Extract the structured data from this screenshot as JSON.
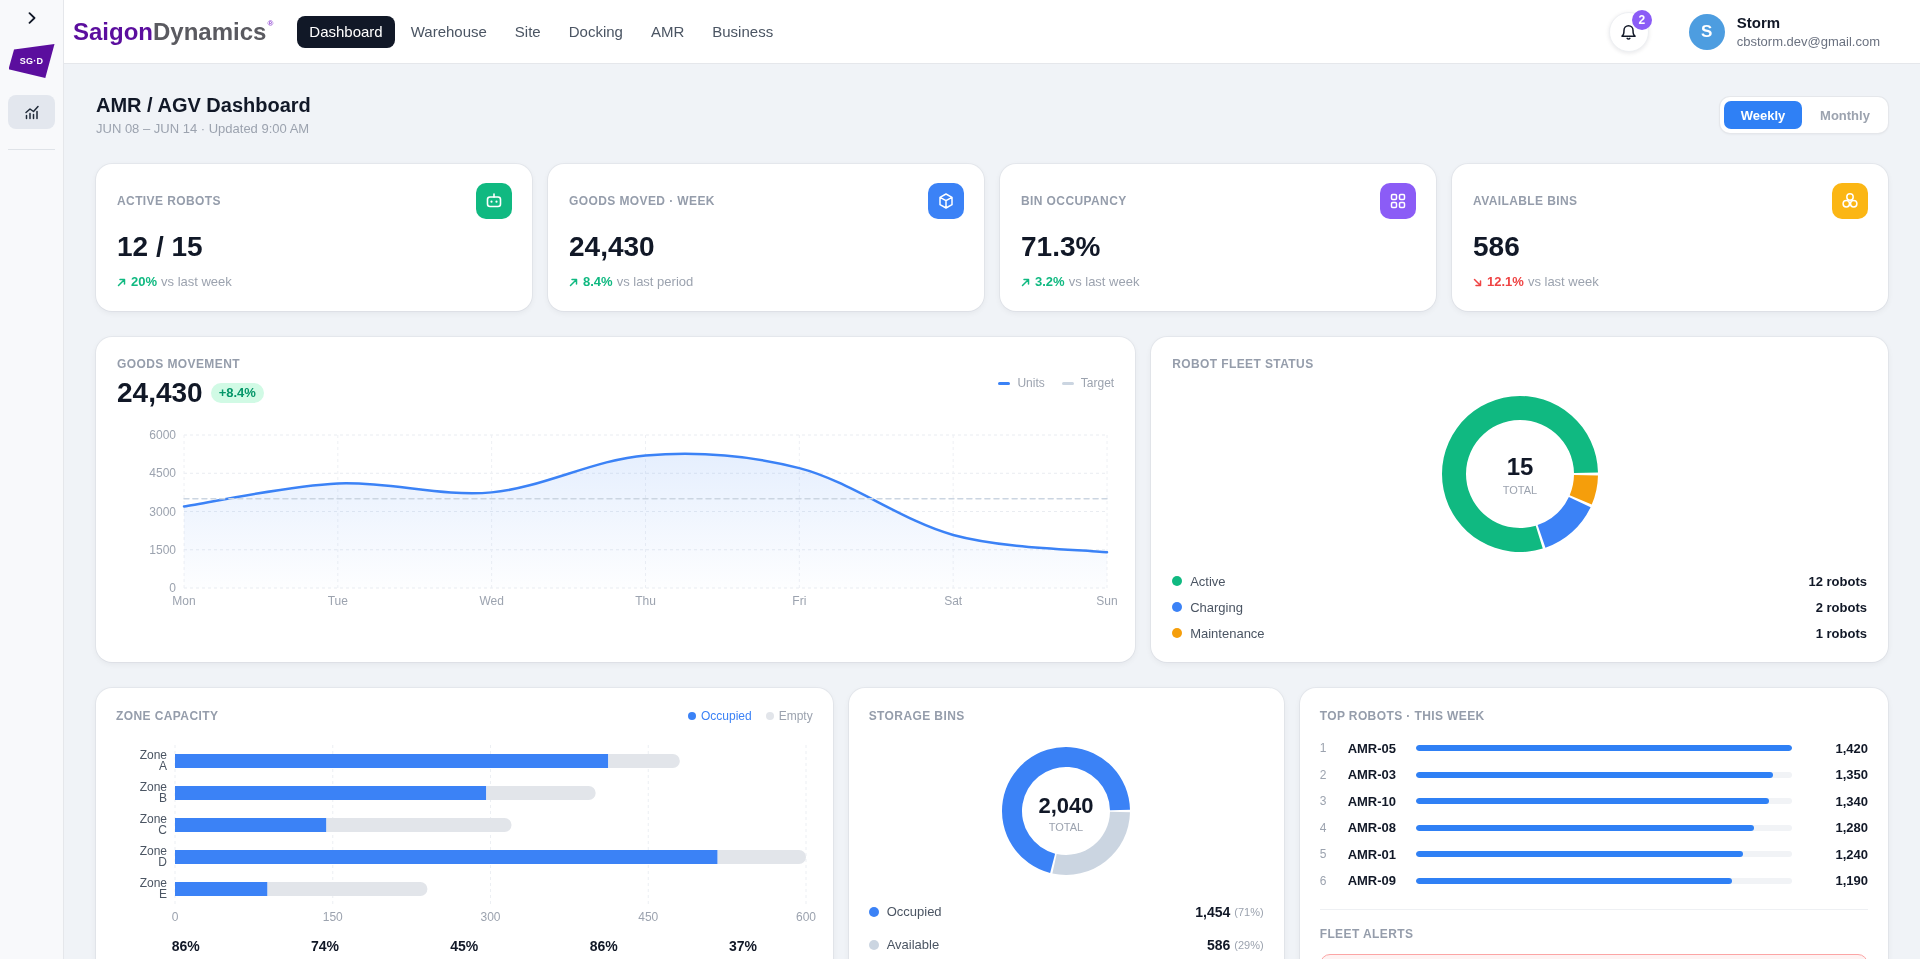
{
  "sidebar": {
    "logo_text": "SG·D",
    "items": [
      {
        "selected": true
      }
    ]
  },
  "topbar": {
    "brand": {
      "primary": "Saigon",
      "secondary": "Dynamics",
      "mark": "®"
    },
    "tabs": [
      {
        "label": "Dashboard",
        "selected": true
      },
      {
        "label": "Warehouse",
        "selected": false
      },
      {
        "label": "Site",
        "selected": false
      },
      {
        "label": "Docking",
        "selected": false
      },
      {
        "label": "AMR",
        "selected": false
      },
      {
        "label": "Business",
        "selected": false
      }
    ],
    "notifications": {
      "count": "2"
    },
    "user": {
      "initial": "S",
      "name": "Storm",
      "email": "cbstorm.dev@gmail.com"
    }
  },
  "header": {
    "title": "AMR / AGV Dashboard",
    "subtitle": "JUN 08 – JUN 14 · Updated 9:00 AM",
    "period_toggle": [
      {
        "label": "Weekly",
        "selected": true
      },
      {
        "label": "Monthly",
        "selected": false
      }
    ]
  },
  "kpis": [
    {
      "label": "ACTIVE ROBOTS",
      "value": "12 / 15",
      "rising": true,
      "delta": "20%",
      "caption": "vs last week",
      "color": "#10b981"
    },
    {
      "label": "GOODS MOVED · WEEK",
      "value": "24,430",
      "rising": true,
      "delta": "8.4%",
      "caption": "vs last period",
      "color": "#3b82f6"
    },
    {
      "label": "BIN OCCUPANCY",
      "value": "71.3%",
      "rising": true,
      "delta": "3.2%",
      "caption": "vs last week",
      "color": "#8b5cf6"
    },
    {
      "label": "AVAILABLE BINS",
      "value": "586",
      "rising": false,
      "delta": "12.1%",
      "caption": "vs last week",
      "color": "#fbb614"
    }
  ],
  "goods_movement": {
    "title": "GOODS MOVEMENT",
    "value": "24,430",
    "badge": "+8.4%",
    "chart_data": {
      "type": "area",
      "grid": true,
      "categories": [
        "Mon",
        "Tue",
        "Wed",
        "Thu",
        "Fri",
        "Sat",
        "Sun"
      ],
      "series": [
        {
          "name": "Units",
          "line_style": "solid",
          "color": "#3b82f6",
          "values": [
            3200,
            4100,
            3750,
            5200,
            4700,
            2080,
            1400
          ]
        },
        {
          "name": "Target",
          "type": "line",
          "line_style": "dashed",
          "color": "#cbd5e1",
          "values": [
            3500,
            3500,
            3500,
            3500,
            3500,
            3500,
            3500
          ]
        }
      ],
      "ylim": [
        0,
        6000
      ],
      "yticks": [
        0,
        1500,
        3000,
        4500,
        6000
      ]
    }
  },
  "fleet_status": {
    "title": "ROBOT FLEET STATUS",
    "chart_data": {
      "type": "donut",
      "categories": [
        "Active",
        "Charging",
        "Maintenance"
      ],
      "values": [
        80,
        13.3,
        6.7
      ]
    },
    "center_value": "15",
    "center_label": "TOTAL",
    "legend": [
      {
        "color": "#10b981",
        "value": "12 robots"
      },
      {
        "color": "#3b82f6",
        "value": "2 robots"
      },
      {
        "color": "#f59e0b",
        "value": "1 robots"
      }
    ]
  },
  "zone_capacity": {
    "title": "ZONE CAPACITY",
    "legend": [
      {
        "selected": true
      },
      {
        "selected": false
      }
    ],
    "chart_data": {
      "type": "bar",
      "orientation": "horizontal",
      "stacked": true,
      "grid": true,
      "categories": [
        "Zone A",
        "Zone B",
        "Zone C",
        "Zone D",
        "Zone E"
      ],
      "series": [
        {
          "name": "Occupied",
          "color": "#3b82f6",
          "values": [
            412,
            296,
            144,
            516,
            88
          ]
        },
        {
          "name": "Empty",
          "color": "#e2e5ea",
          "values": [
            68,
            104,
            176,
            84,
            152
          ]
        }
      ],
      "xlim": [
        0,
        600
      ],
      "xticks": [
        0,
        150,
        300,
        450,
        600
      ]
    },
    "utilization": [
      "86%",
      "74%",
      "45%",
      "86%",
      "37%"
    ]
  },
  "storage_bins": {
    "title": "STORAGE BINS",
    "chart_data": {
      "type": "donut",
      "categories": [
        "Occupied",
        "Available"
      ],
      "values": [
        71.3,
        28.7
      ]
    },
    "center_value": "2,040",
    "center_label": "TOTAL",
    "legend": [
      {
        "color": "#3b82f6",
        "value": "1,454",
        "share": "(71%)"
      },
      {
        "color": "#cbd5e1",
        "value": "586",
        "share": "(29%)"
      }
    ]
  },
  "top_robots": {
    "title": "TOP ROBOTS · THIS WEEK",
    "rows": [
      {
        "rank": "1",
        "name": "AMR-05",
        "value": "1,420",
        "level": 1
      },
      {
        "rank": "2",
        "name": "AMR-03",
        "value": "1,350",
        "level": 0.95
      },
      {
        "rank": "3",
        "name": "AMR-10",
        "value": "1,340",
        "level": 0.94
      },
      {
        "rank": "4",
        "name": "AMR-08",
        "value": "1,280",
        "level": 0.9
      },
      {
        "rank": "5",
        "name": "AMR-01",
        "value": "1,240",
        "level": 0.87
      },
      {
        "rank": "6",
        "name": "AMR-09",
        "value": "1,190",
        "level": 0.84
      }
    ]
  },
  "fleet_alerts": {
    "title": "FLEET ALERTS",
    "alerts": [
      {
        "kind": "error"
      }
    ]
  }
}
